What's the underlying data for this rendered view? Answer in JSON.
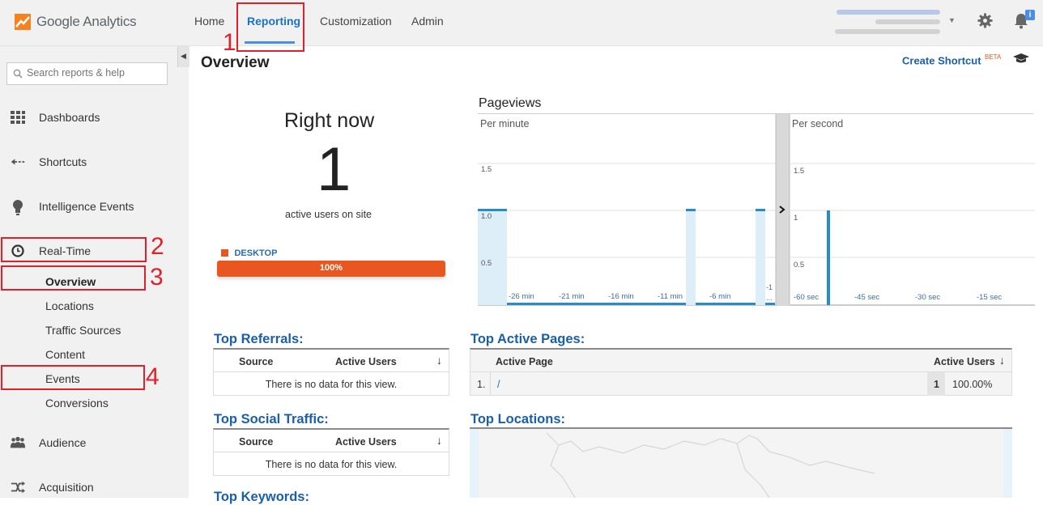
{
  "app": {
    "name": "Google Analytics"
  },
  "nav": {
    "items": [
      "Home",
      "Reporting",
      "Customization",
      "Admin"
    ],
    "active": "Reporting"
  },
  "annotations": [
    "1",
    "2",
    "3",
    "4"
  ],
  "sidebar": {
    "search_placeholder": "Search reports & help",
    "items": [
      {
        "label": "Dashboards",
        "icon": "grid-icon"
      },
      {
        "label": "Shortcuts",
        "icon": "shortcut-arrow-icon"
      },
      {
        "label": "Intelligence Events",
        "icon": "lightbulb-icon"
      },
      {
        "label": "Real-Time",
        "icon": "clock-icon"
      },
      {
        "label": "Audience",
        "icon": "people-icon"
      },
      {
        "label": "Acquisition",
        "icon": "acquisition-arrows-icon"
      }
    ],
    "realtime_sub": [
      "Overview",
      "Locations",
      "Traffic Sources",
      "Content",
      "Events",
      "Conversions"
    ]
  },
  "main": {
    "title": "Overview",
    "create_shortcut": "Create Shortcut",
    "beta": "BETA",
    "right_now": {
      "heading": "Right now",
      "count": "1",
      "caption": "active users on site",
      "device_label": "DESKTOP",
      "device_percent": 1.0,
      "device_percent_label": "100%",
      "device_color": "#e8571f"
    },
    "pageviews": {
      "title": "Pageviews",
      "per_minute": {
        "label": "Per minute",
        "yticks": [
          "1.5",
          "1.0",
          "0.5"
        ],
        "xticks": [
          "-26 min",
          "-21 min",
          "-16 min",
          "-11 min",
          "-6 min",
          "-1 ..."
        ]
      },
      "per_second": {
        "label": "Per second",
        "yticks": [
          "1.5",
          "1",
          "0.5"
        ],
        "xticks": [
          "-60 sec",
          "-45 sec",
          "-30 sec",
          "-15 sec"
        ]
      }
    },
    "top_referrals": {
      "title": "Top Referrals:",
      "columns": [
        "Source",
        "Active Users"
      ],
      "empty": "There is no data for this view."
    },
    "top_social": {
      "title": "Top Social Traffic:",
      "columns": [
        "Source",
        "Active Users"
      ],
      "empty": "There is no data for this view."
    },
    "top_keywords": {
      "title": "Top Keywords:"
    },
    "top_active_pages": {
      "title": "Top Active Pages:",
      "columns": [
        "Active Page",
        "Active Users"
      ],
      "rows": [
        {
          "rank": "1.",
          "page": "/",
          "users": "1",
          "percent": "100.00%"
        }
      ]
    },
    "top_locations": {
      "title": "Top Locations:"
    }
  },
  "colors": {
    "accent_blue": "#1a5faa",
    "bar_blue": "#2a8cc4",
    "annotation_red": "#e0212b",
    "desktop_orange": "#e8571f"
  }
}
